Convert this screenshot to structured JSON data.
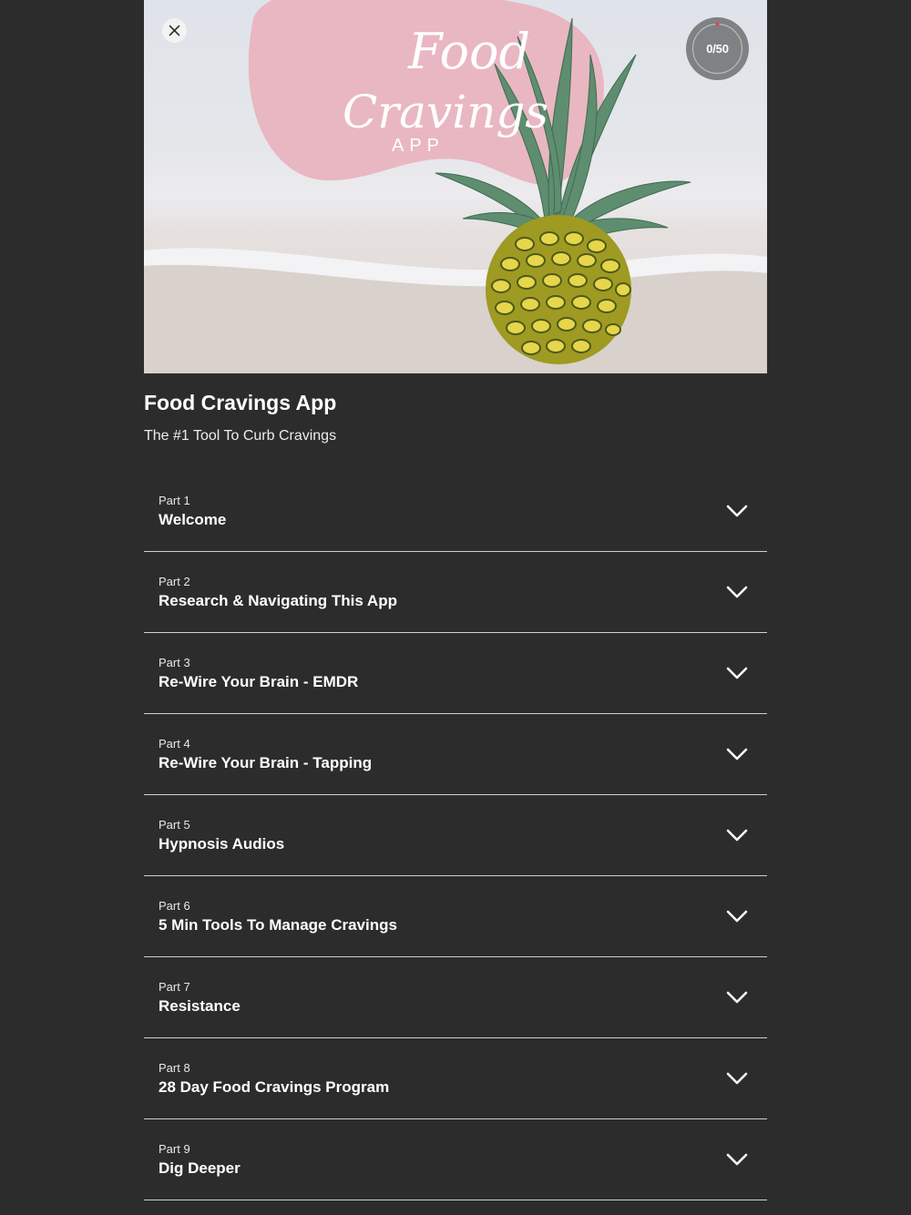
{
  "hero": {
    "logo_line1": "Food",
    "logo_line2": "Cravings",
    "logo_line3": "APP",
    "close_icon": "close-icon",
    "progress": {
      "completed": 0,
      "total": 50,
      "label": "0/50"
    },
    "colors": {
      "blob": "#e9b7c1",
      "progress_bg": "#808183",
      "progress_dot": "#e0415f"
    }
  },
  "course": {
    "title": "Food Cravings App",
    "subtitle": "The #1 Tool To Curb Cravings"
  },
  "parts": [
    {
      "num": "Part 1",
      "title": "Welcome"
    },
    {
      "num": "Part 2",
      "title": "Research & Navigating This App"
    },
    {
      "num": "Part 3",
      "title": "Re-Wire Your Brain - EMDR"
    },
    {
      "num": "Part 4",
      "title": "Re-Wire Your Brain - Tapping"
    },
    {
      "num": "Part 5",
      "title": "Hypnosis Audios"
    },
    {
      "num": "Part 6",
      "title": "5 Min Tools To Manage Cravings"
    },
    {
      "num": "Part 7",
      "title": "Resistance"
    },
    {
      "num": "Part 8",
      "title": "28 Day Food Cravings Program"
    },
    {
      "num": "Part 9",
      "title": "Dig Deeper"
    }
  ],
  "icons": {
    "expand": "chevron-down-icon"
  },
  "theme": {
    "background": "#2d2c2d",
    "divider": "#cfcfcf"
  }
}
